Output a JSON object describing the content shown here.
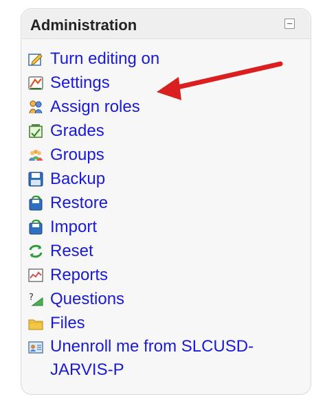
{
  "panel": {
    "title": "Administration",
    "collapse_icon": "minus-icon"
  },
  "items": [
    {
      "label": "Turn editing on",
      "icon": "edit-icon"
    },
    {
      "label": "Settings",
      "icon": "settings-icon"
    },
    {
      "label": "Assign roles",
      "icon": "roles-icon"
    },
    {
      "label": "Grades",
      "icon": "grades-icon"
    },
    {
      "label": "Groups",
      "icon": "groups-icon"
    },
    {
      "label": "Backup",
      "icon": "backup-icon"
    },
    {
      "label": "Restore",
      "icon": "restore-icon"
    },
    {
      "label": "Import",
      "icon": "import-icon"
    },
    {
      "label": "Reset",
      "icon": "reset-icon"
    },
    {
      "label": "Reports",
      "icon": "reports-icon"
    },
    {
      "label": "Questions",
      "icon": "questions-icon"
    },
    {
      "label": "Files",
      "icon": "files-icon"
    },
    {
      "label": "Unenroll me from SLCUSD-JARVIS-P",
      "icon": "unenroll-icon"
    }
  ],
  "annotation": {
    "arrow_color": "#e02020",
    "points_to": "Settings"
  }
}
